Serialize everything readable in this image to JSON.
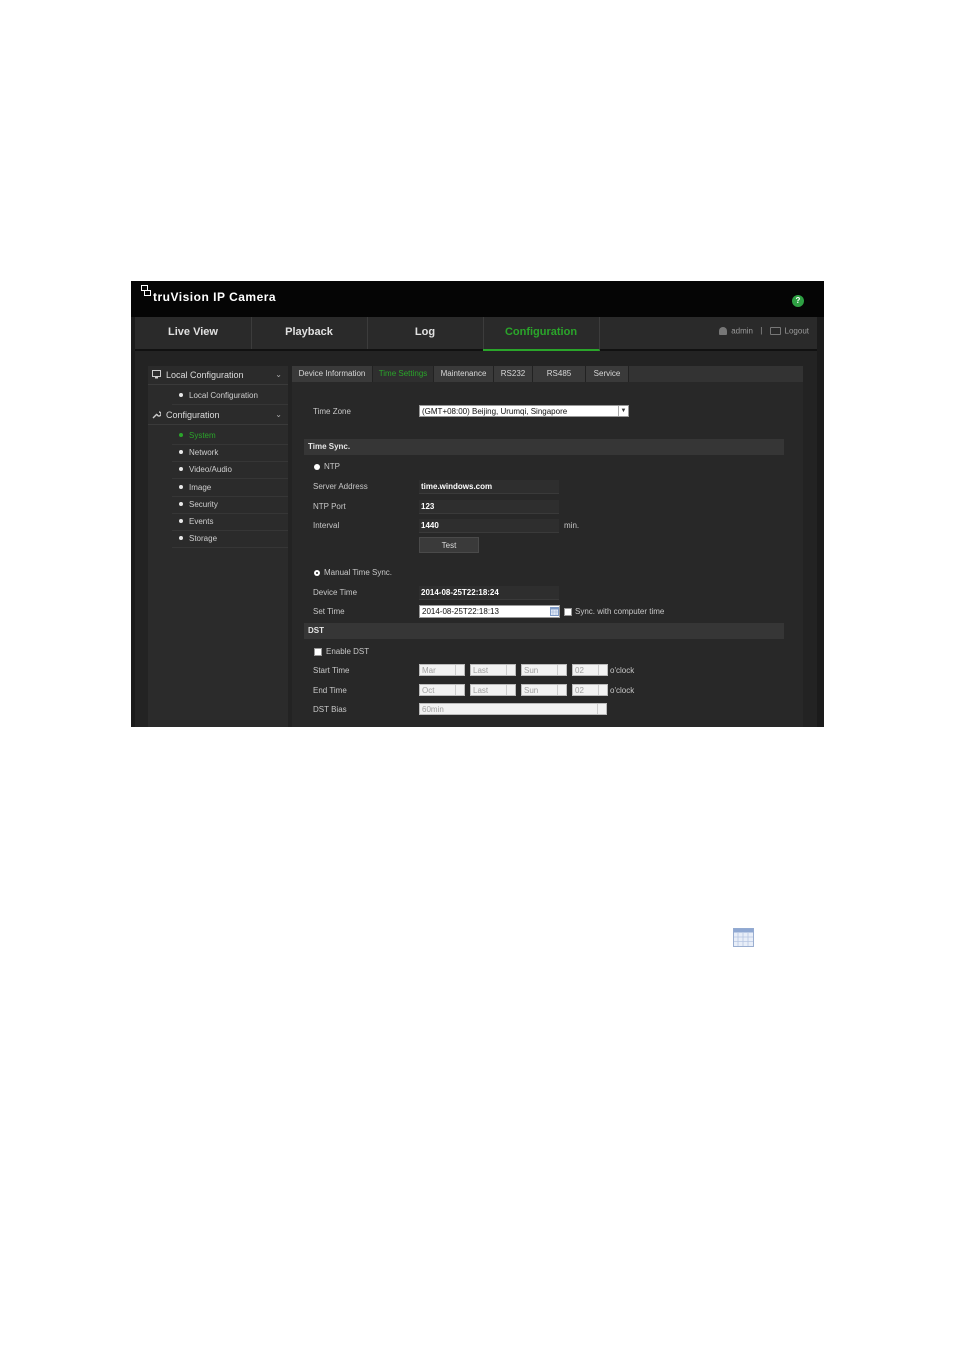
{
  "app": {
    "brand": "truVision  IP Camera",
    "help_symbol": "?"
  },
  "nav": {
    "tabs": [
      "Live View",
      "Playback",
      "Log",
      "Configuration"
    ],
    "active": "Configuration",
    "user": "admin",
    "separator": "|",
    "logout": "Logout"
  },
  "sidebar": {
    "local_heading": "Local Configuration",
    "local_items": [
      "Local Configuration"
    ],
    "config_heading": "Configuration",
    "config_items": [
      "System",
      "Network",
      "Video/Audio",
      "Image",
      "Security",
      "Events",
      "Storage"
    ],
    "active_item": "System",
    "chevron": "⌄"
  },
  "subtabs": [
    "Device Information",
    "Time Settings",
    "Maintenance",
    "RS232",
    "RS485",
    "Service"
  ],
  "active_subtab": "Time Settings",
  "form": {
    "time_zone_label": "Time Zone",
    "time_zone_value": "(GMT+08:00) Beijing, Urumqi, Singapore",
    "time_sync_section": "Time Sync.",
    "ntp_label": "NTP",
    "server_address_label": "Server Address",
    "server_address_value": "time.windows.com",
    "ntp_port_label": "NTP Port",
    "ntp_port_value": "123",
    "interval_label": "Interval",
    "interval_value": "1440",
    "interval_unit": "min.",
    "test_button": "Test",
    "manual_sync_label": "Manual Time Sync.",
    "device_time_label": "Device Time",
    "device_time_value": "2014-08-25T22:18:24",
    "set_time_label": "Set Time",
    "set_time_value": "2014-08-25T22:18:13",
    "sync_computer_label": "Sync. with computer time",
    "dst_section": "DST",
    "enable_dst_label": "Enable DST",
    "start_time_label": "Start Time",
    "start": {
      "month": "Mar",
      "week": "Last",
      "day": "Sun",
      "hour": "02"
    },
    "end_time_label": "End Time",
    "end": {
      "month": "Oct",
      "week": "Last",
      "day": "Sun",
      "hour": "02"
    },
    "oclock": "o'clock",
    "dst_bias_label": "DST Bias",
    "dst_bias_value": "60min"
  },
  "colors": {
    "accent": "#2aa52a",
    "background": "#1b1b1b"
  }
}
